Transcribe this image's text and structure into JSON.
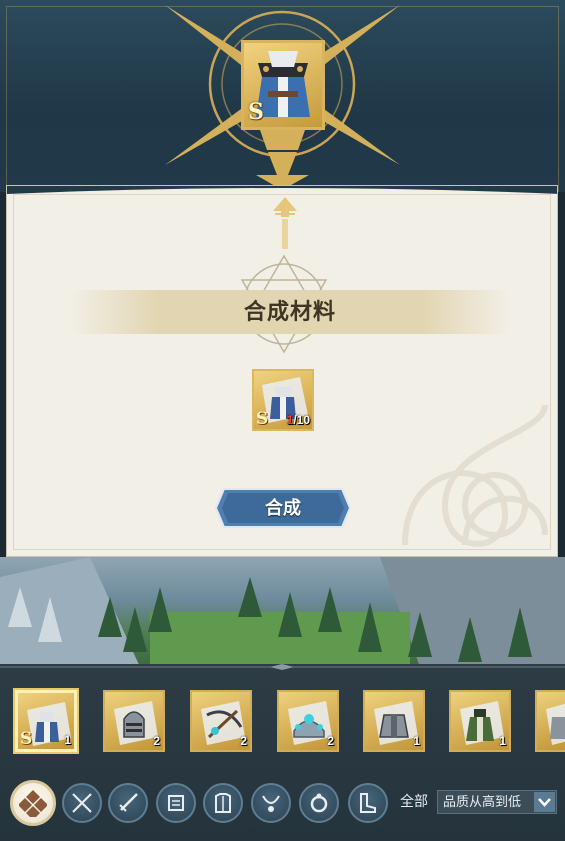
{
  "result_item": {
    "grade": "S"
  },
  "materials_panel": {
    "title": "合成材料",
    "material": {
      "grade": "S",
      "have": "1",
      "need": "/10"
    },
    "compose_button": "合成"
  },
  "inventory": {
    "items": [
      {
        "grade": "S",
        "qty": "1",
        "icon": "hooded-cloak-icon",
        "selected": true
      },
      {
        "grade": "",
        "qty": "2",
        "icon": "knight-helmet-icon"
      },
      {
        "grade": "",
        "qty": "2",
        "icon": "crossbow-icon"
      },
      {
        "grade": "",
        "qty": "2",
        "icon": "tiara-icon"
      },
      {
        "grade": "",
        "qty": "1",
        "icon": "shoulder-armor-icon"
      },
      {
        "grade": "",
        "qty": "1",
        "icon": "robe-icon"
      },
      {
        "grade": "",
        "qty": "",
        "icon": "armor-partial-icon"
      }
    ]
  },
  "filters": {
    "icons": [
      "all-diamond-icon",
      "crossed-swords-icon",
      "sword-icon",
      "scroll-icon",
      "chest-armor-icon",
      "necklace-icon",
      "ring-icon",
      "boots-icon"
    ],
    "all_label": "全部",
    "sort_label": "品质从高到低"
  },
  "colors": {
    "gold": "#d8b45e",
    "panel": "#f2efe6",
    "button": "#3f6b9a"
  }
}
